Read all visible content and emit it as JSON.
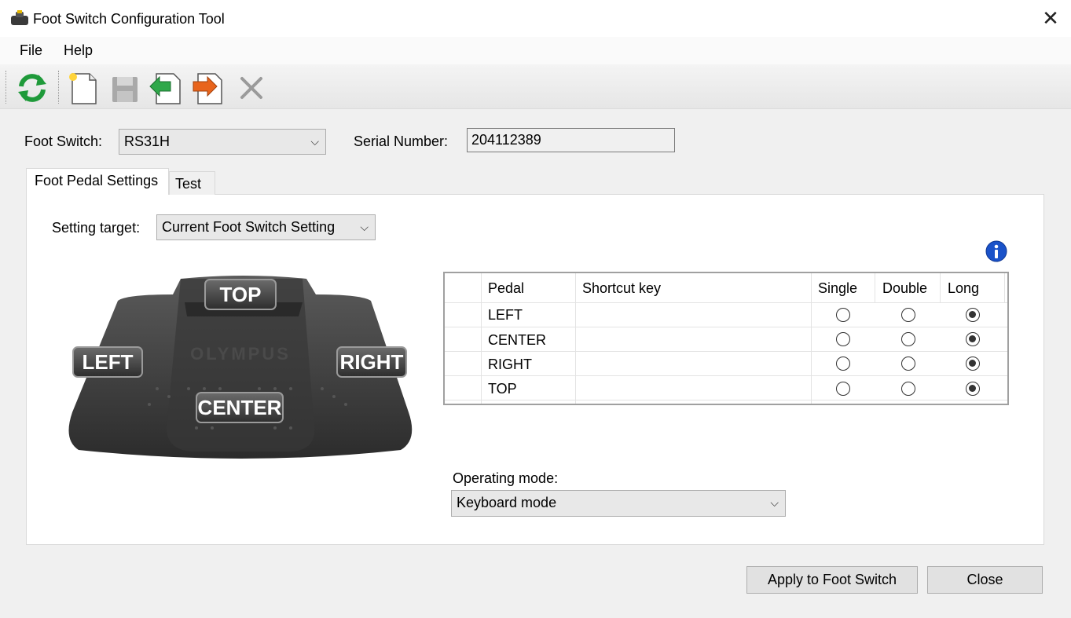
{
  "window": {
    "title": "Foot Switch Configuration Tool"
  },
  "menu": {
    "items": [
      "File",
      "Help"
    ]
  },
  "toolbar": {
    "buttons": [
      {
        "icon": "refresh-icon"
      },
      {
        "icon": "new-document-icon"
      },
      {
        "icon": "save-icon"
      },
      {
        "icon": "import-icon"
      },
      {
        "icon": "export-icon"
      },
      {
        "icon": "delete-icon"
      }
    ]
  },
  "foot_switch": {
    "label": "Foot Switch:",
    "value": "RS31H",
    "serial_label": "Serial Number:",
    "serial_value": "204112389"
  },
  "tabs": [
    {
      "label": "Foot Pedal Settings",
      "active": true
    },
    {
      "label": "Test",
      "active": false
    }
  ],
  "settings": {
    "target_label": "Setting target:",
    "target_value": "Current Foot Switch Setting"
  },
  "pedal_image": {
    "labels": {
      "top": "TOP",
      "left": "LEFT",
      "right": "RIGHT",
      "center": "CENTER"
    },
    "brand": "OLYMPUS"
  },
  "grid": {
    "headers": {
      "pedal": "Pedal",
      "shortcut": "Shortcut key",
      "single": "Single",
      "double": "Double",
      "long": "Long"
    },
    "rows": [
      {
        "pedal": "LEFT",
        "shortcut": "",
        "mode": "long"
      },
      {
        "pedal": "CENTER",
        "shortcut": "",
        "mode": "long"
      },
      {
        "pedal": "RIGHT",
        "shortcut": "",
        "mode": "long"
      },
      {
        "pedal": "TOP",
        "shortcut": "",
        "mode": "long"
      }
    ]
  },
  "operating_mode": {
    "label": "Operating mode:",
    "value": "Keyboard mode"
  },
  "buttons": {
    "apply": "Apply to Foot Switch",
    "close": "Close"
  },
  "colors": {
    "info_blue": "#1a52c9",
    "refresh_green": "#1f9a3a",
    "arrow_orange": "#e8641c"
  }
}
